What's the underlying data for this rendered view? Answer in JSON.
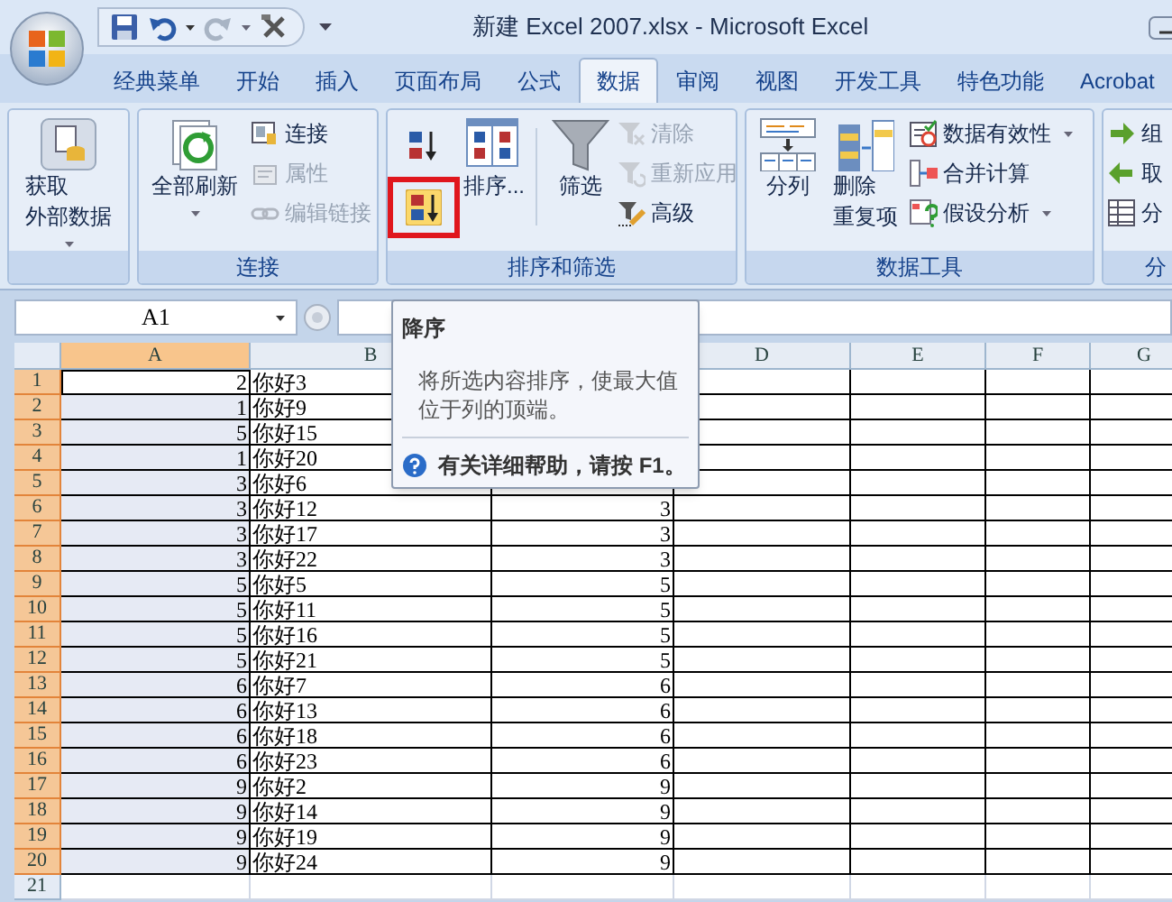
{
  "window": {
    "title": "新建 Excel 2007.xlsx - Microsoft Excel"
  },
  "tabs": [
    {
      "label": "经典菜单",
      "selected": false
    },
    {
      "label": "开始",
      "selected": false
    },
    {
      "label": "插入",
      "selected": false
    },
    {
      "label": "页面布局",
      "selected": false
    },
    {
      "label": "公式",
      "selected": false
    },
    {
      "label": "数据",
      "selected": true
    },
    {
      "label": "审阅",
      "selected": false
    },
    {
      "label": "视图",
      "selected": false
    },
    {
      "label": "开发工具",
      "selected": false
    },
    {
      "label": "特色功能",
      "selected": false
    },
    {
      "label": "Acrobat",
      "selected": false
    }
  ],
  "ribbon": {
    "groups": [
      {
        "kind": "external",
        "large": [
          {
            "lines": [
              "获取",
              "外部数据"
            ],
            "dropdown": true
          }
        ]
      },
      {
        "kind": "connections",
        "title": "连接",
        "large": [
          {
            "lines": [
              "全部刷新"
            ],
            "dropdown": true
          }
        ],
        "small": [
          {
            "label": "连接",
            "disabled": false,
            "dropdown": false
          },
          {
            "label": "属性",
            "disabled": true,
            "dropdown": false
          },
          {
            "label": "编辑链接",
            "disabled": true,
            "dropdown": false
          }
        ]
      },
      {
        "kind": "sort_filter",
        "title": "排序和筛选",
        "sort": [
          {
            "highlighted": false
          },
          {
            "highlighted": true
          }
        ],
        "large": [
          {
            "lines": [
              "排序..."
            ],
            "dropdown": false
          },
          {
            "lines": [
              "筛选"
            ],
            "dropdown": false
          }
        ],
        "small": [
          {
            "label": "清除",
            "disabled": true,
            "dropdown": false
          },
          {
            "label": "重新应用",
            "disabled": true,
            "dropdown": false
          },
          {
            "label": "高级",
            "disabled": false,
            "dropdown": false
          }
        ]
      },
      {
        "kind": "data_tools",
        "title": "数据工具",
        "large": [
          {
            "lines": [
              "分列"
            ],
            "dropdown": false
          },
          {
            "lines": [
              "删除",
              "重复项"
            ],
            "dropdown": false
          }
        ],
        "small": [
          {
            "label": "数据有效性",
            "disabled": false,
            "dropdown": true
          },
          {
            "label": "合并计算",
            "disabled": false,
            "dropdown": false
          },
          {
            "label": "假设分析",
            "disabled": false,
            "dropdown": true
          }
        ]
      },
      {
        "kind": "outline",
        "title": "分",
        "small": [
          {
            "label": "组",
            "disabled": false,
            "dropdown": false
          },
          {
            "label": "取",
            "disabled": false,
            "dropdown": false
          },
          {
            "label": "分",
            "disabled": false,
            "dropdown": false
          }
        ]
      }
    ]
  },
  "name_box": {
    "value": "A1"
  },
  "tooltip": {
    "title": "降序",
    "body": "将所选内容排序，使最大值位于列的顶端。",
    "help": "有关详细帮助，请按 **F1**。"
  },
  "columns": [
    {
      "label": "A",
      "selected": true
    },
    {
      "label": "B",
      "selected": false
    },
    {},
    {
      "label": "D",
      "selected": false
    },
    {
      "label": "E",
      "selected": false
    },
    {
      "label": "F",
      "selected": false
    },
    {
      "label": "G",
      "selected": false
    }
  ],
  "rows": [
    {
      "header": "1",
      "selected": true,
      "active": true,
      "bordered": true,
      "cells": [
        "2",
        "你好3",
        null
      ]
    },
    {
      "header": "2",
      "selected": true,
      "active": false,
      "bordered": true,
      "cells": [
        "1",
        "你好9",
        null
      ]
    },
    {
      "header": "3",
      "selected": true,
      "active": false,
      "bordered": true,
      "cells": [
        "5",
        "你好15",
        null
      ]
    },
    {
      "header": "4",
      "selected": true,
      "active": false,
      "bordered": true,
      "cells": [
        "1",
        "你好20",
        null
      ]
    },
    {
      "header": "5",
      "selected": true,
      "active": false,
      "bordered": true,
      "cells": [
        "3",
        "你好6",
        null
      ]
    },
    {
      "header": "6",
      "selected": true,
      "active": false,
      "bordered": true,
      "cells": [
        "3",
        "你好12",
        "3"
      ]
    },
    {
      "header": "7",
      "selected": true,
      "active": false,
      "bordered": true,
      "cells": [
        "3",
        "你好17",
        "3"
      ]
    },
    {
      "header": "8",
      "selected": true,
      "active": false,
      "bordered": true,
      "cells": [
        "3",
        "你好22",
        "3"
      ]
    },
    {
      "header": "9",
      "selected": true,
      "active": false,
      "bordered": true,
      "cells": [
        "5",
        "你好5",
        "5"
      ]
    },
    {
      "header": "10",
      "selected": true,
      "active": false,
      "bordered": true,
      "cells": [
        "5",
        "你好11",
        "5"
      ]
    },
    {
      "header": "11",
      "selected": true,
      "active": false,
      "bordered": true,
      "cells": [
        "5",
        "你好16",
        "5"
      ]
    },
    {
      "header": "12",
      "selected": true,
      "active": false,
      "bordered": true,
      "cells": [
        "5",
        "你好21",
        "5"
      ]
    },
    {
      "header": "13",
      "selected": true,
      "active": false,
      "bordered": true,
      "cells": [
        "6",
        "你好7",
        "6"
      ]
    },
    {
      "header": "14",
      "selected": true,
      "active": false,
      "bordered": true,
      "cells": [
        "6",
        "你好13",
        "6"
      ]
    },
    {
      "header": "15",
      "selected": true,
      "active": false,
      "bordered": true,
      "cells": [
        "6",
        "你好18",
        "6"
      ]
    },
    {
      "header": "16",
      "selected": true,
      "active": false,
      "bordered": true,
      "cells": [
        "6",
        "你好23",
        "6"
      ]
    },
    {
      "header": "17",
      "selected": true,
      "active": false,
      "bordered": true,
      "cells": [
        "9",
        "你好2",
        "9"
      ]
    },
    {
      "header": "18",
      "selected": true,
      "active": false,
      "bordered": true,
      "cells": [
        "9",
        "你好14",
        "9"
      ]
    },
    {
      "header": "19",
      "selected": true,
      "active": false,
      "bordered": true,
      "cells": [
        "9",
        "你好19",
        "9"
      ]
    },
    {
      "header": "20",
      "selected": true,
      "active": false,
      "bordered": true,
      "cells": [
        "9",
        "你好24",
        "9"
      ]
    },
    {
      "header": "21",
      "selected": false,
      "active": false,
      "bordered": false,
      "cells": []
    }
  ]
}
